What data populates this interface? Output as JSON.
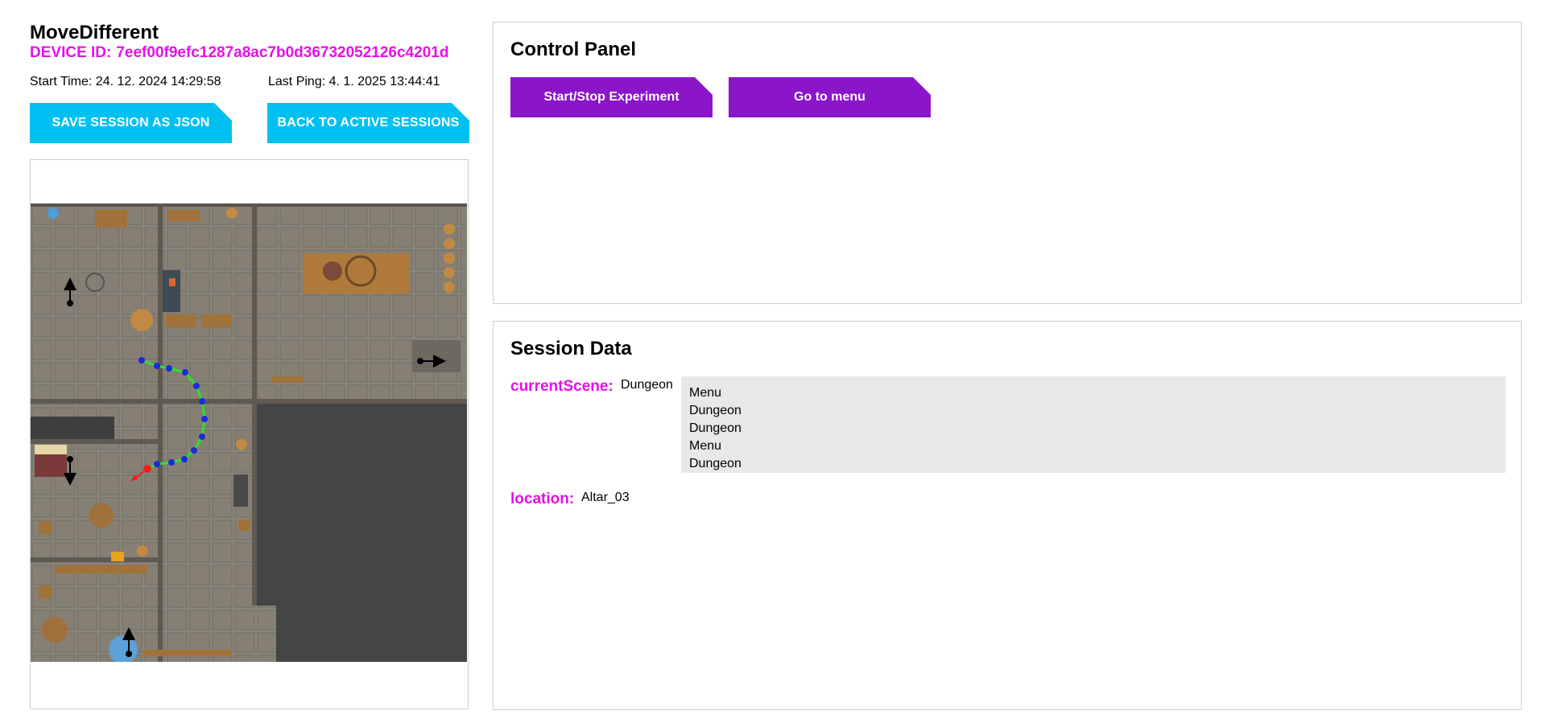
{
  "header": {
    "title": "MoveDifferent",
    "device_id_label": "DEVICE ID:",
    "device_id": "7eef00f9efc1287a8ac7b0d36732052126c4201d",
    "start_time": "Start Time: 24. 12. 2024 14:29:58",
    "last_ping": "Last Ping: 4. 1. 2025 13:44:41"
  },
  "actions": {
    "save_label": "SAVE SESSION AS JSON",
    "back_label": "BACK TO ACTIVE SESSIONS"
  },
  "control_panel": {
    "title": "Control Panel",
    "start_stop_label": "Start/Stop Experiment",
    "menu_label": "Go to menu"
  },
  "session_data": {
    "title": "Session Data",
    "current_scene_label": "currentScene:",
    "current_scene_value": "Dungeon",
    "scene_history": [
      "Menu",
      "Dungeon",
      "Dungeon",
      "Menu",
      "Dungeon"
    ],
    "location_label": "location:",
    "location_value": "Altar_03"
  },
  "colors": {
    "accent_magenta": "#e610e6",
    "cyan_button": "#00c0f2",
    "purple_button": "#8b15c9",
    "path_blue": "#1a2bd8",
    "path_green": "#2ee02e",
    "current_red": "#ff1a1a"
  },
  "icons": {
    "map": "dungeon-map-image"
  }
}
